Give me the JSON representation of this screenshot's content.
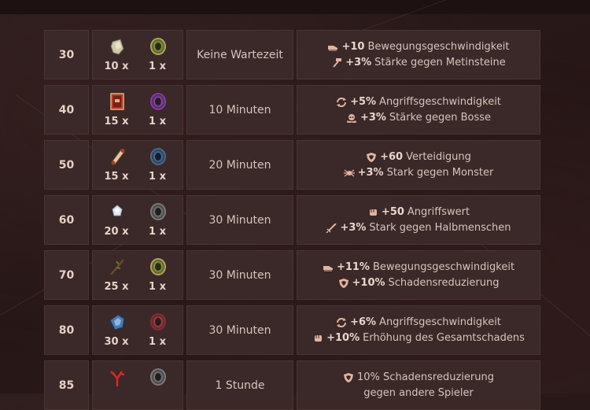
{
  "rows": [
    {
      "level": "30",
      "item1": {
        "icon": "stone-sack-icon",
        "count": "10 x"
      },
      "item2": {
        "icon": "green-ring-icon",
        "count": "1 x"
      },
      "time": "Keine Wartezeit",
      "bonus": [
        {
          "icon": "boots-icon",
          "value": "+10",
          "text": "Bewegungsgeschwindigkeit"
        },
        {
          "icon": "hammer-icon",
          "value": "+3%",
          "text": "Stärke gegen Metinsteine"
        }
      ]
    },
    {
      "level": "40",
      "item1": {
        "icon": "red-book-icon",
        "count": "15 x"
      },
      "item2": {
        "icon": "purple-ring-icon",
        "count": "1 x"
      },
      "time": "10 Minuten",
      "bonus": [
        {
          "icon": "arrows-cycle-icon",
          "value": "+5%",
          "text": "Angriffsgeschwindigkeit"
        },
        {
          "icon": "skull-icon",
          "value": "+3%",
          "text": "Stärke gegen Bosse"
        }
      ]
    },
    {
      "level": "50",
      "item1": {
        "icon": "scroll-icon",
        "count": "15 x"
      },
      "item2": {
        "icon": "blue-ring-icon",
        "count": "1 x"
      },
      "time": "20 Minuten",
      "bonus": [
        {
          "icon": "shield-icon",
          "value": "+60",
          "text": "Verteidigung"
        },
        {
          "icon": "spider-icon",
          "value": "+3%",
          "text": "Stark gegen Monster"
        }
      ]
    },
    {
      "level": "60",
      "item1": {
        "icon": "crystal-icon",
        "count": "20 x"
      },
      "item2": {
        "icon": "grey-ring-icon",
        "count": "1 x"
      },
      "time": "30 Minuten",
      "bonus": [
        {
          "icon": "fist-icon",
          "value": "+50",
          "text": "Angriffswert"
        },
        {
          "icon": "sword-icon",
          "value": "+3%",
          "text": "Stark gegen Halbmenschen"
        }
      ]
    },
    {
      "level": "70",
      "item1": {
        "icon": "branch-icon",
        "count": "25 x"
      },
      "item2": {
        "icon": "green-ring-icon",
        "count": "1 x"
      },
      "time": "30 Minuten",
      "bonus": [
        {
          "icon": "boots-icon",
          "value": "+11%",
          "text": "Bewegungsgeschwindigkeit"
        },
        {
          "icon": "shield-icon",
          "value": "+10%",
          "text": "Schadensreduzierung"
        }
      ]
    },
    {
      "level": "80",
      "item1": {
        "icon": "blue-ore-icon",
        "count": "30 x"
      },
      "item2": {
        "icon": "red-ring-icon",
        "count": "1 x"
      },
      "time": "30 Minuten",
      "bonus": [
        {
          "icon": "arrows-cycle-icon",
          "value": "+6%",
          "text": "Angriffsgeschwindigkeit"
        },
        {
          "icon": "fist-icon",
          "value": "+10%",
          "text": "Erhöhung des Gesamtschadens"
        }
      ]
    },
    {
      "level": "85",
      "item1": {
        "icon": "red-coral-icon",
        "count": ""
      },
      "item2": {
        "icon": "grey-ring-icon",
        "count": ""
      },
      "time": "1 Stunde",
      "bonus": [
        {
          "icon": "shield-icon",
          "value": "",
          "text": "10% Schadensreduzierung"
        },
        {
          "icon": "",
          "value": "",
          "text": "gegen andere Spieler"
        }
      ]
    }
  ],
  "colors": {
    "accent": "#e2b4a0",
    "cell": "#3b2828",
    "background": "#2a1a1a"
  }
}
